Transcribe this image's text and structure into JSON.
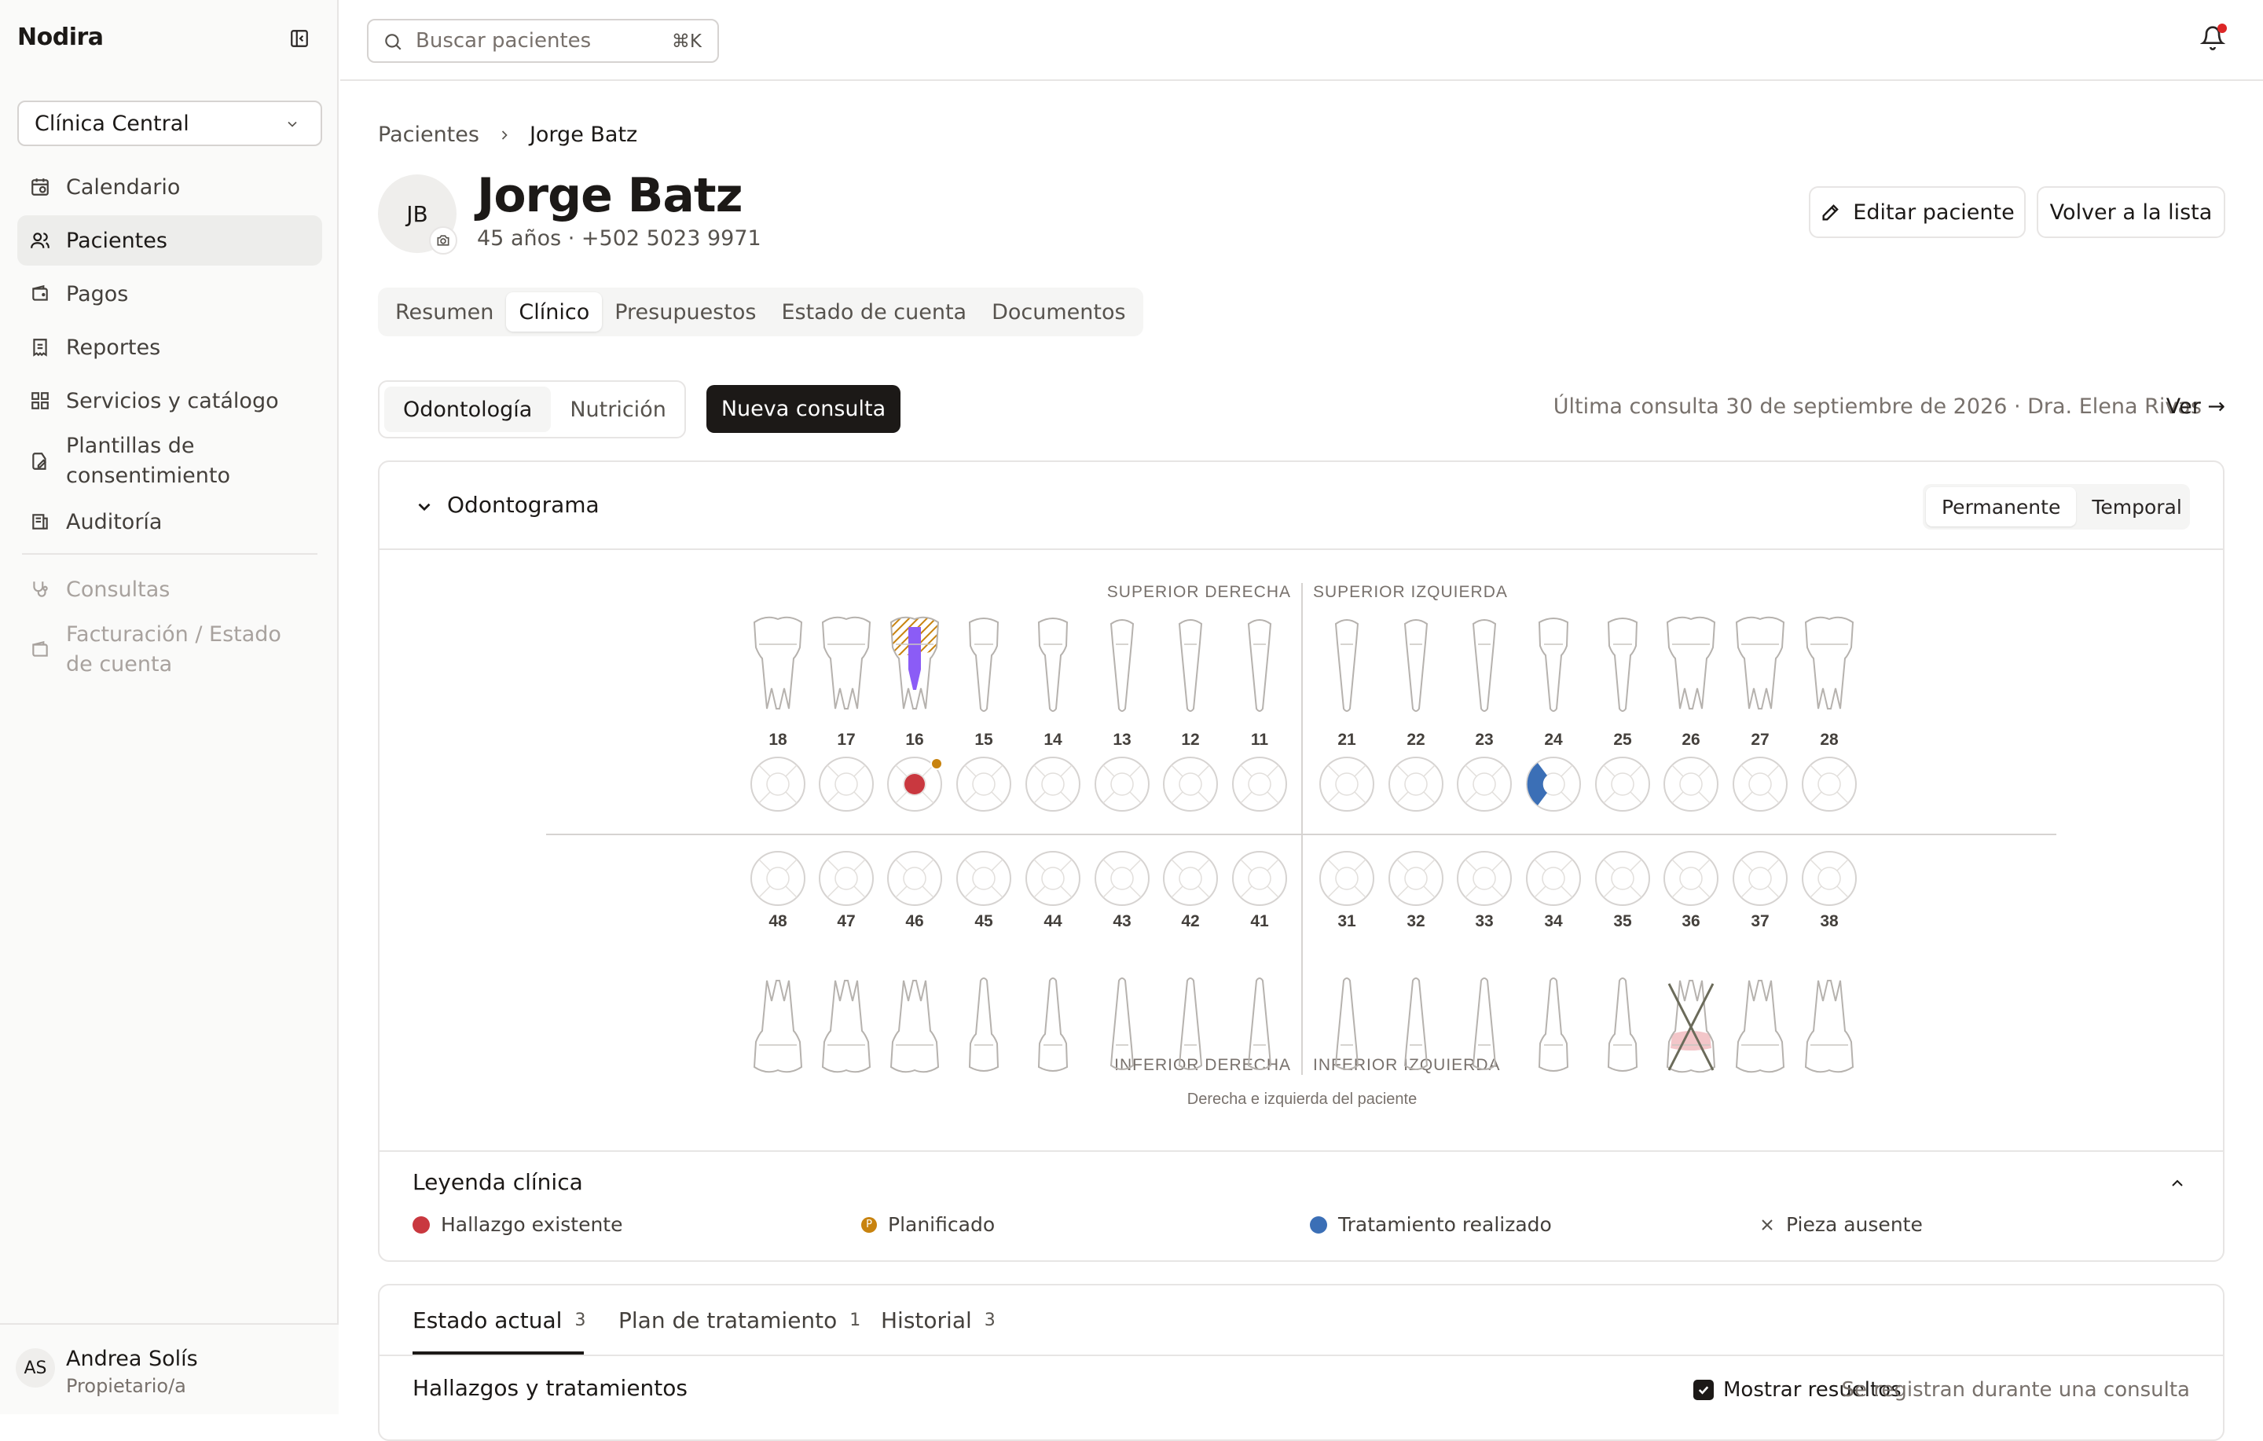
{
  "app": {
    "brand": "Nodira"
  },
  "sidebar": {
    "clinic": "Clínica Central",
    "items": [
      {
        "label": "Calendario",
        "icon": "calendar-icon"
      },
      {
        "label": "Pacientes",
        "icon": "users-icon",
        "active": true
      },
      {
        "label": "Pagos",
        "icon": "wallet-icon"
      },
      {
        "label": "Reportes",
        "icon": "receipt-icon"
      },
      {
        "label": "Servicios y catálogo",
        "icon": "grid-icon"
      },
      {
        "label": "Plantillas de consentimiento",
        "icon": "file-signature-icon"
      },
      {
        "label": "Auditoría",
        "icon": "audit-icon"
      }
    ],
    "disabled_items": [
      {
        "label": "Consultas",
        "icon": "stethoscope-icon"
      },
      {
        "label": "Facturación / Estado de cuenta",
        "icon": "wallet-icon"
      }
    ],
    "user": {
      "initials": "AS",
      "name": "Andrea Solís",
      "role": "Propietario/a"
    }
  },
  "topbar": {
    "search_placeholder": "Buscar pacientes",
    "shortcut": "⌘K"
  },
  "breadcrumb": {
    "parent": "Pacientes",
    "current": "Jorge Batz"
  },
  "patient": {
    "initials": "JB",
    "name": "Jorge Batz",
    "meta": "45 años · +502 5023 9971"
  },
  "actions": {
    "edit": "Editar paciente",
    "back": "Volver a la lista"
  },
  "tabs": [
    "Resumen",
    "Clínico",
    "Presupuestos",
    "Estado de cuenta",
    "Documentos"
  ],
  "active_tab": "Clínico",
  "clinical": {
    "segments": [
      "Odontología",
      "Nutrición"
    ],
    "new_consult": "Nueva consulta",
    "last_consult": "Última consulta 30 de septiembre de 2026 · Dra. Elena Rivas",
    "view": "Ver →"
  },
  "odontogram": {
    "title": "Odontograma",
    "dentition": [
      "Permanente",
      "Temporal"
    ],
    "quadrants": {
      "ur": "SUPERIOR DERECHA",
      "ul": "SUPERIOR IZQUIERDA",
      "lr": "INFERIOR DERECHA",
      "ll": "INFERIOR IZQUIERDA"
    },
    "upper": [
      "18",
      "17",
      "16",
      "15",
      "14",
      "13",
      "12",
      "11",
      "21",
      "22",
      "23",
      "24",
      "25",
      "26",
      "27",
      "28"
    ],
    "lower": [
      "48",
      "47",
      "46",
      "45",
      "44",
      "43",
      "42",
      "41",
      "31",
      "32",
      "33",
      "34",
      "35",
      "36",
      "37",
      "38"
    ],
    "note": "Derecha e izquierda del paciente",
    "colors": {
      "finding": "#c9383f",
      "planned": "#c8830f",
      "done": "#3b6fb6",
      "absent": "#6b6b5a"
    }
  },
  "legend": {
    "title": "Leyenda clínica",
    "finding": "Hallazgo existente",
    "planned": "Planificado",
    "planned_mark": "P",
    "done": "Tratamiento realizado",
    "absent": "Pieza ausente"
  },
  "bottom": {
    "tabs": [
      {
        "label": "Estado actual",
        "count": "3"
      },
      {
        "label": "Plan de tratamiento",
        "count": "1"
      },
      {
        "label": "Historial",
        "count": "3"
      }
    ],
    "section": "Hallazgos y tratamientos",
    "show_resolved": "Mostrar resueltos",
    "note": "Se registran durante una consulta"
  }
}
